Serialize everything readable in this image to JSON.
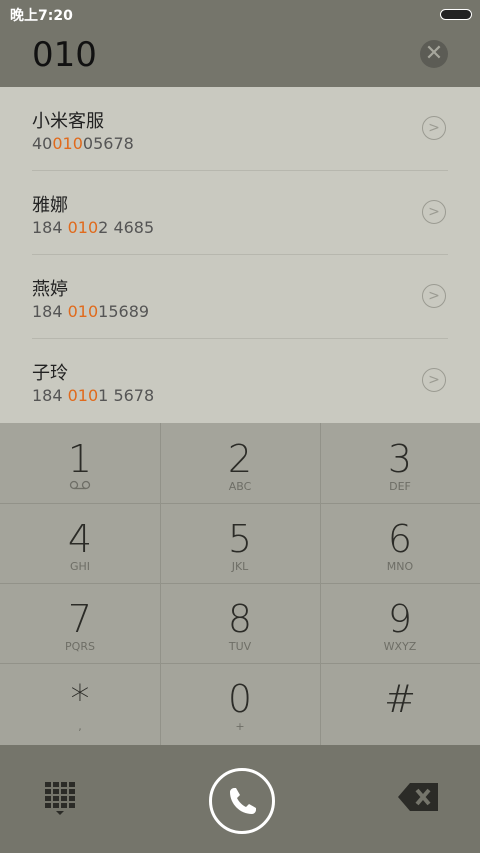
{
  "status": {
    "time": "晚上7:20"
  },
  "search": {
    "query": "010",
    "clear_icon": "close-icon"
  },
  "results": [
    {
      "name": "小米客服",
      "num_pre": "40",
      "num_hl": "010",
      "num_post": "05678"
    },
    {
      "name": "雅娜",
      "num_pre": "184 ",
      "num_hl": "010",
      "num_post": "2 4685"
    },
    {
      "name": "燕婷",
      "num_pre": "184 ",
      "num_hl": "010",
      "num_post": "15689"
    },
    {
      "name": "子玲",
      "num_pre": "184 ",
      "num_hl": "010",
      "num_post": "1 5678"
    }
  ],
  "keys": [
    {
      "digit": "1",
      "letters": "",
      "icon": "voicemail-icon"
    },
    {
      "digit": "2",
      "letters": "ABC"
    },
    {
      "digit": "3",
      "letters": "DEF"
    },
    {
      "digit": "4",
      "letters": "GHI"
    },
    {
      "digit": "5",
      "letters": "JKL"
    },
    {
      "digit": "6",
      "letters": "MNO"
    },
    {
      "digit": "7",
      "letters": "PQRS"
    },
    {
      "digit": "8",
      "letters": "TUV"
    },
    {
      "digit": "9",
      "letters": "WXYZ"
    },
    {
      "digit": "*",
      "letters": ","
    },
    {
      "digit": "0",
      "letters": "+"
    },
    {
      "digit": "#",
      "letters": ""
    }
  ],
  "colors": {
    "highlight": "#e06a1c",
    "bar": "#75756b",
    "list_bg": "#c9c9c0",
    "keypad_bg": "#a4a49b"
  }
}
